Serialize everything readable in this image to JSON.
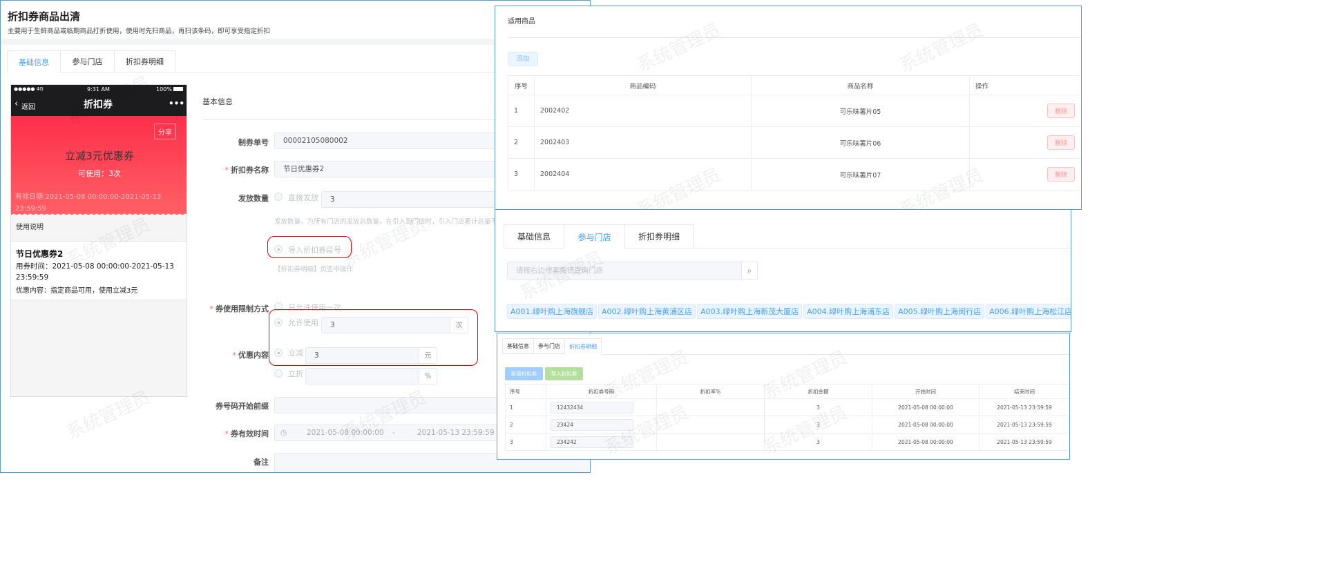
{
  "main": {
    "title": "折扣券商品出清",
    "subtitle": "主要用于生鲜商品或临期商品打折使用，使用时先扫商品，再扫该条码，即可享受指定折扣",
    "tabs": [
      "基础信息",
      "参与门店",
      "折扣券明细"
    ],
    "active_tab": 0,
    "phone": {
      "signal": "●●●●● 4G",
      "time": "9:31 AM",
      "battery": "100%",
      "back": "返回",
      "nav_title": "折扣券",
      "more": "•••",
      "share": "分享",
      "coupon_title": "立减3元优惠券",
      "usable": "可使用：3次",
      "validity": "有效日期:2021-05-08 00:00:00-2021-05-13 23:59:59",
      "usage_header": "使用说明",
      "coupon_name": "节日优惠券2",
      "use_time": "用券时间：2021-05-08 00:00:00-2021-05-13 23:59:59",
      "content": "优惠内容：指定商品可用，使用立减3元"
    },
    "form": {
      "section": "基本信息",
      "voucher_no_label": "制券单号",
      "voucher_no": "00002105080002",
      "name_label": "折扣券名称",
      "name": "节日优惠券2",
      "qty_label": "发放数量",
      "direct_issue": "直接发放",
      "direct_qty": "3",
      "qty_help": "发放数量，为所有门店的发放总数量，在引入到门店时，引入门店累计总量不",
      "import_segment": "导入折扣券段号",
      "import_help": "【折扣券明细】页签中操作",
      "limit_label": "券使用限制方式",
      "once": "只允许使用一次",
      "allow": "允许使用",
      "allow_count": "3",
      "allow_unit": "次",
      "discount_label": "优惠内容",
      "reduce": "立减",
      "reduce_value": "3",
      "reduce_unit": "元",
      "percent_off": "立折",
      "percent_value": "",
      "percent_unit": "%",
      "prefix_label": "券号码开始前缀",
      "prefix": "",
      "validity_label": "券有效时间",
      "start": "2021-05-08 00:00:00",
      "sep": "-",
      "end": "2021-05-13 23:59:59",
      "remark_label": "备注"
    }
  },
  "products": {
    "title": "适用商品",
    "add": "添加",
    "columns": [
      "序号",
      "商品编码",
      "商品名称",
      "操作"
    ],
    "rows": [
      {
        "no": "1",
        "code": "2002402",
        "name": "可乐味薯片05",
        "action": "删除"
      },
      {
        "no": "2",
        "code": "2002403",
        "name": "可乐味薯片06",
        "action": "删除"
      },
      {
        "no": "3",
        "code": "2002404",
        "name": "可乐味薯片07",
        "action": "删除"
      }
    ]
  },
  "stores": {
    "tabs": [
      "基础信息",
      "参与门店",
      "折扣券明细"
    ],
    "active_tab": 1,
    "search_placeholder": "请按右边搜索按钮查询门店",
    "tags": [
      "A001.绿叶购上海旗舰店",
      "A002.绿叶购上海黄浦区店",
      "A003.绿叶购上海新茂大厦店",
      "A004.绿叶购上海浦东店",
      "A005.绿叶购上海闵行店",
      "A006.绿叶购上海松江店"
    ]
  },
  "details": {
    "tabs": [
      "基础信息",
      "参与门店",
      "折扣券明细"
    ],
    "active_tab": 2,
    "new": "新增折扣券",
    "import": "导入折扣券",
    "columns": [
      "序号",
      "折扣券号码",
      "折扣率%",
      "折扣金额",
      "开始时间",
      "结束时间"
    ],
    "rows": [
      {
        "no": "1",
        "code": "12432434",
        "rate": "",
        "amount": "3",
        "start": "2021-05-08 00:00:00",
        "end": "2021-05-13 23:59:59"
      },
      {
        "no": "2",
        "code": "23424",
        "rate": "",
        "amount": "3",
        "start": "2021-05-08 00:00:00",
        "end": "2021-05-13 23:59:59"
      },
      {
        "no": "3",
        "code": "234242",
        "rate": "",
        "amount": "3",
        "start": "2021-05-08 00:00:00",
        "end": "2021-05-13 23:59:59"
      }
    ]
  },
  "watermark": "系统管理员",
  "colors": {
    "accent": "#409eff",
    "border": "#5b9bd5",
    "coupon_red": "#ff3450",
    "highlight": "#e00000"
  }
}
